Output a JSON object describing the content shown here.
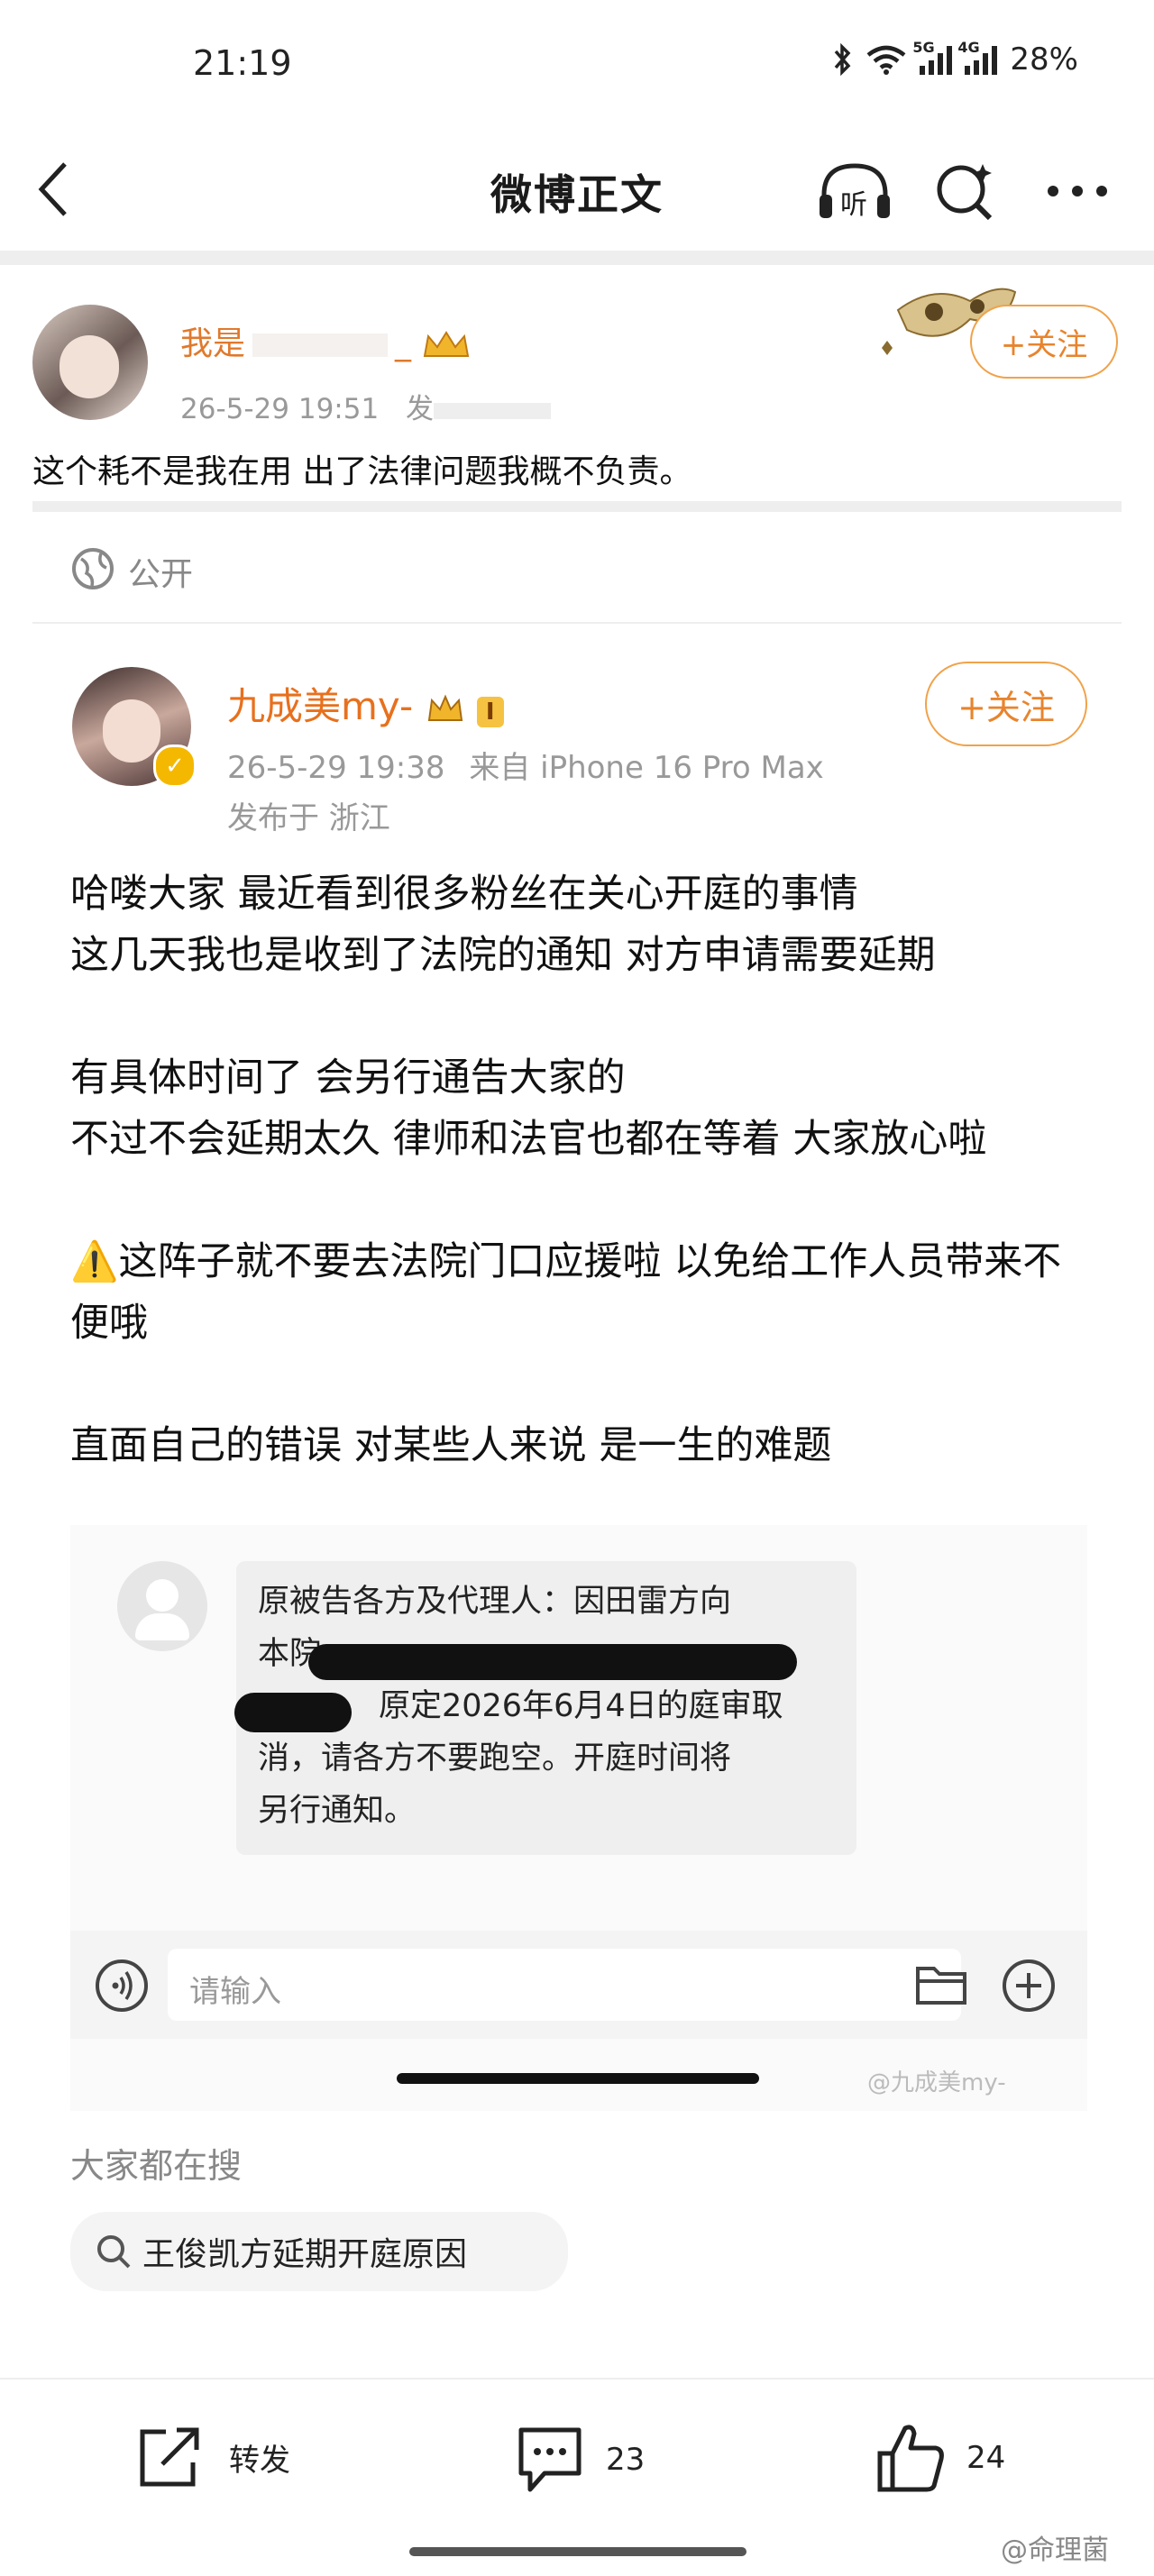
{
  "status": {
    "time": "21:19",
    "network_a": "5G",
    "network_b": "4G",
    "battery": "28%"
  },
  "nav": {
    "title": "微博正文",
    "listen_label": "听"
  },
  "original_post": {
    "author": "我是",
    "author_suffix": "_",
    "time": "26-5-29 19:51",
    "source_prefix": "发",
    "follow_label": "+关注",
    "text": "这个耗不是我在用 出了法律问题我概不负责。"
  },
  "visibility": {
    "label": "公开"
  },
  "quoted_post": {
    "author": "九成美my-",
    "vip_level": "I",
    "time": "26-5-29 19:38",
    "source": "来自 iPhone 16 Pro Max",
    "location": "发布于 浙江",
    "follow_label": "+关注",
    "paragraphs": [
      "哈喽大家 最近看到很多粉丝在关心开庭的事情\n这几天我也是收到了法院的通知 对方申请需要延期",
      "有具体时间了 会另行通告大家的\n不过不会延期太久 律师和法官也都在等着 大家放心啦",
      "⚠️这阵子就不要去法院门口应援啦 以免给工作人员带来不便哦",
      "直面自己的错误 对某些人来说 是一生的难题"
    ]
  },
  "screenshot_message": {
    "line1": "原被告各方及代理人：因田雷方向",
    "line2": "本院",
    "line3": "原定2026年6月4日的庭审取",
    "line4": "消，请各方不要跑空。开庭时间将",
    "line5": "另行通知。",
    "input_placeholder": "请输入",
    "watermark": "@九成美my-"
  },
  "search": {
    "heading": "大家都在搜",
    "suggestion": "王俊凯方延期开庭原因"
  },
  "bottom_bar": {
    "repost_label": "转发",
    "comment_count": "23",
    "like_count": "24"
  },
  "footer_watermark": "@命理菌"
}
